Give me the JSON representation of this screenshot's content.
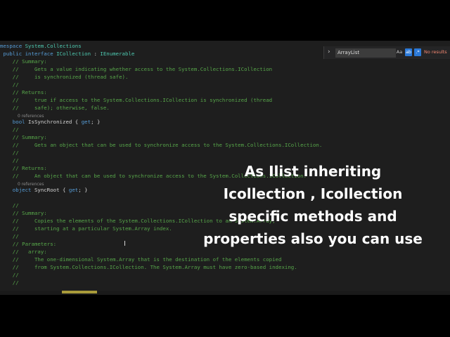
{
  "editor": {
    "lines": [
      {
        "type": "code",
        "segs": [
          [
            "k",
            "mespace "
          ],
          [
            "t",
            "System.Collections"
          ]
        ]
      },
      {
        "type": "code",
        "segs": [
          [
            "k",
            " public interface "
          ],
          [
            "t",
            "ICollection"
          ],
          [
            "p",
            " : "
          ],
          [
            "t",
            "IEnumerable"
          ]
        ]
      },
      {
        "type": "code",
        "segs": [
          [
            "c",
            "    // Summary:"
          ]
        ]
      },
      {
        "type": "code",
        "segs": [
          [
            "c",
            "    //     Gets a value indicating whether access to the System.Collections.ICollection"
          ]
        ]
      },
      {
        "type": "code",
        "segs": [
          [
            "c",
            "    //     is synchronized (thread safe)."
          ]
        ]
      },
      {
        "type": "code",
        "segs": [
          [
            "c",
            "    //"
          ]
        ]
      },
      {
        "type": "code",
        "segs": [
          [
            "c",
            "    // Returns:"
          ]
        ]
      },
      {
        "type": "code",
        "segs": [
          [
            "c",
            "    //     true if access to the System.Collections.ICollection is synchronized (thread"
          ]
        ]
      },
      {
        "type": "code",
        "segs": [
          [
            "c",
            "    //     safe); otherwise, false."
          ]
        ]
      },
      {
        "type": "ref",
        "text": "0 references"
      },
      {
        "type": "code",
        "segs": [
          [
            "k",
            "    bool "
          ],
          [
            "p",
            "IsSynchronized { "
          ],
          [
            "k",
            "get"
          ],
          [
            "p",
            "; }"
          ]
        ]
      },
      {
        "type": "code",
        "segs": [
          [
            "c",
            "    //"
          ]
        ]
      },
      {
        "type": "code",
        "segs": [
          [
            "c",
            "    // Summary:"
          ]
        ]
      },
      {
        "type": "code",
        "segs": [
          [
            "c",
            "    //     Gets an object that can be used to synchronize access to the System.Collections.ICollection."
          ]
        ]
      },
      {
        "type": "code",
        "segs": [
          [
            "c",
            "    //"
          ]
        ]
      },
      {
        "type": "code",
        "segs": [
          [
            "c",
            "    //"
          ]
        ]
      },
      {
        "type": "code",
        "segs": [
          [
            "c",
            "    // Returns:"
          ]
        ]
      },
      {
        "type": "code",
        "segs": [
          [
            "c",
            "    //     An object that can be used to synchronize access to the System.Collections.ICollection."
          ]
        ]
      },
      {
        "type": "ref",
        "text": "0 references"
      },
      {
        "type": "code",
        "segs": [
          [
            "k",
            "    object "
          ],
          [
            "p",
            "SyncRoot { "
          ],
          [
            "k",
            "get"
          ],
          [
            "p",
            "; }"
          ]
        ]
      },
      {
        "type": "code",
        "segs": [
          [
            "p",
            ""
          ]
        ]
      },
      {
        "type": "code",
        "segs": [
          [
            "c",
            "    //"
          ]
        ]
      },
      {
        "type": "code",
        "segs": [
          [
            "c",
            "    // Summary:"
          ]
        ]
      },
      {
        "type": "code",
        "segs": [
          [
            "c",
            "    //     Copies the elements of the System.Collections.ICollection to an System.Array,"
          ]
        ]
      },
      {
        "type": "code",
        "segs": [
          [
            "c",
            "    //     starting at a particular System.Array index."
          ]
        ]
      },
      {
        "type": "code",
        "segs": [
          [
            "c",
            "    //"
          ]
        ]
      },
      {
        "type": "code",
        "segs": [
          [
            "c",
            "    // Parameters:"
          ]
        ]
      },
      {
        "type": "code",
        "segs": [
          [
            "c",
            "    //   array:"
          ]
        ]
      },
      {
        "type": "code",
        "segs": [
          [
            "c",
            "    //     The one-dimensional System.Array that is the destination of the elements copied"
          ]
        ]
      },
      {
        "type": "code",
        "segs": [
          [
            "c",
            "    //     from System.Collections.ICollection. The System.Array must have zero-based indexing."
          ]
        ]
      },
      {
        "type": "code",
        "segs": [
          [
            "c",
            "    //"
          ]
        ]
      },
      {
        "type": "code",
        "segs": [
          [
            "c",
            "    //"
          ]
        ]
      }
    ]
  },
  "find": {
    "chevron": "›",
    "query": "ArrayList",
    "match_case": "Aa",
    "whole_word": "ab",
    "regex": ".*",
    "status": "No results"
  },
  "cursor_glyph": "I",
  "caption": {
    "lines": [
      "As Ilist inheriting",
      "Icollection , Icollection",
      "specific methods and",
      "properties also you can use"
    ]
  },
  "colors": {
    "comment": "#57a64a",
    "keyword": "#569cd6",
    "type": "#4ec9b0",
    "plain": "#d4d4d4",
    "background": "#1e1e1e"
  }
}
